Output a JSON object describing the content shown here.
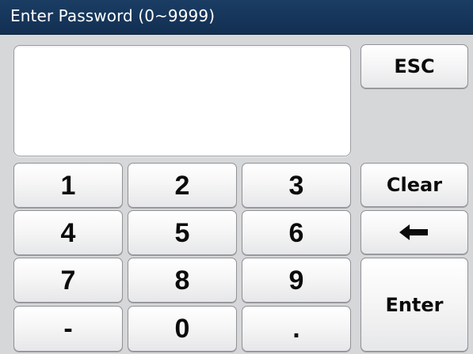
{
  "dialog": {
    "title": "Enter Password (0~9999)"
  },
  "display": {
    "value": ""
  },
  "keys": {
    "k1": "1",
    "k2": "2",
    "k3": "3",
    "k4": "4",
    "k5": "5",
    "k6": "6",
    "k7": "7",
    "k8": "8",
    "k9": "9",
    "k0": "0",
    "minus": "-",
    "dot": "."
  },
  "function_keys": {
    "esc": "ESC",
    "clear": "Clear",
    "backspace_icon": "left-arrow",
    "enter": "Enter"
  },
  "colors": {
    "titlebar": "#15365b",
    "background": "#d6d7d9",
    "key_face": "#f4f4f4"
  }
}
